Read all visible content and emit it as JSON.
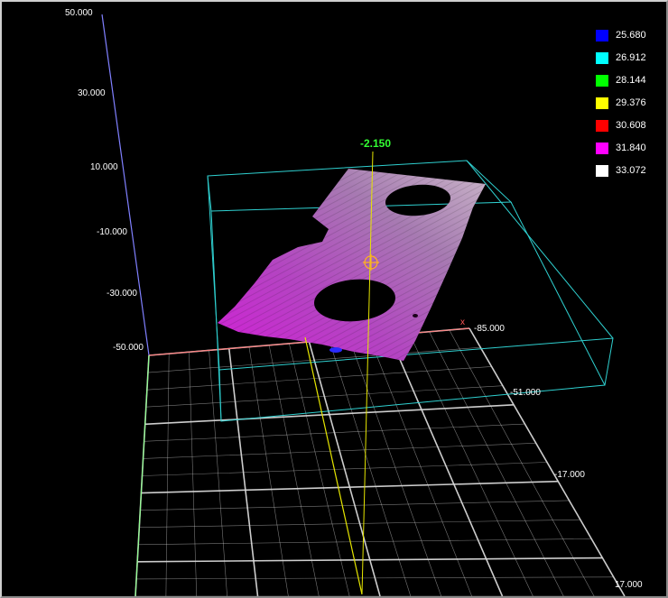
{
  "z_axis": {
    "ticks": [
      "50.000",
      "30.000",
      "10.000",
      "-10.000",
      "-30.000",
      "-50.000"
    ]
  },
  "y_axis": {
    "ticks": [
      "-85.000",
      "-51.000",
      "-17.000",
      "17.000"
    ],
    "label": "x"
  },
  "probe": {
    "value": "-2.150"
  },
  "legend": {
    "items": [
      {
        "value": "25.680",
        "color": "#0000ff"
      },
      {
        "value": "26.912",
        "color": "#00ffff"
      },
      {
        "value": "28.144",
        "color": "#00ff00"
      },
      {
        "value": "29.376",
        "color": "#ffff00"
      },
      {
        "value": "30.608",
        "color": "#ff0000"
      },
      {
        "value": "31.840",
        "color": "#ff00ff"
      },
      {
        "value": "33.072",
        "color": "#ffffff"
      }
    ]
  },
  "colors": {
    "bounding_box": "#2fd0d0",
    "grid": "#d8d8d8",
    "z_axis_line": "#8080ff",
    "x_axis_line": "#ff8080",
    "y_axis_line": "#90ff90",
    "probe_line": "#e6e600",
    "probe_marker": "#ffb020"
  }
}
